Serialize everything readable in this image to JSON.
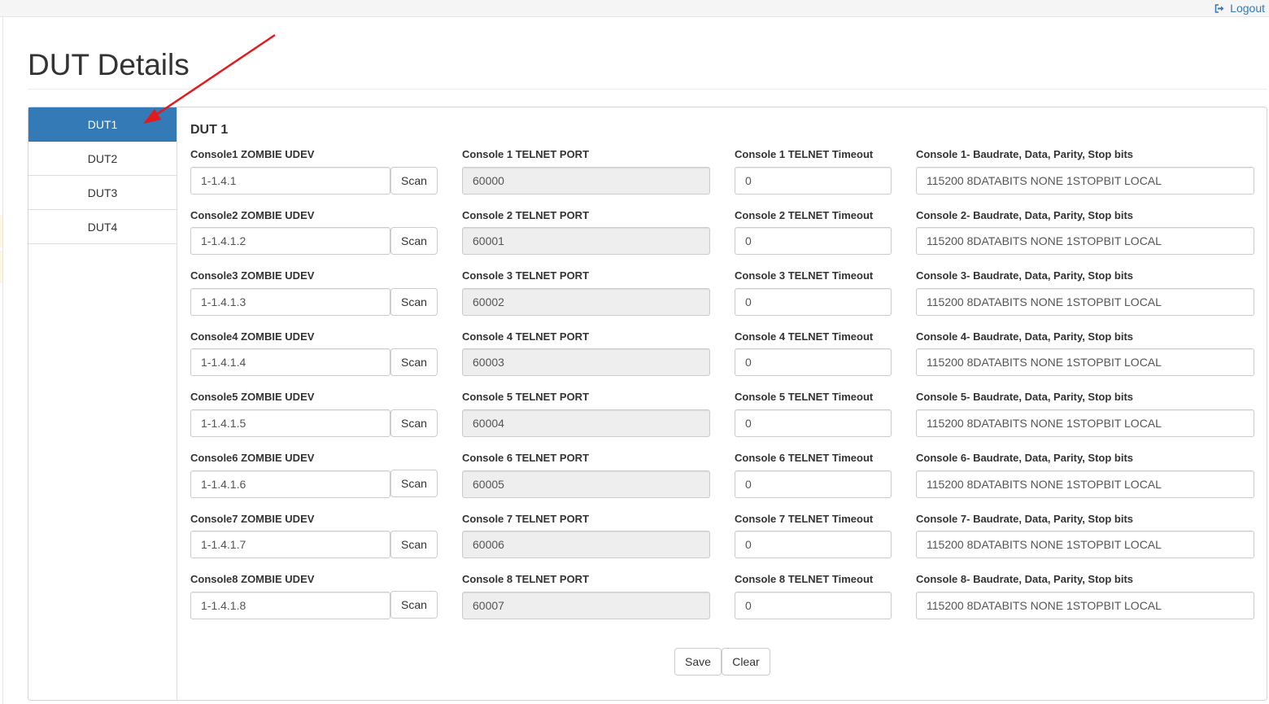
{
  "header": {
    "logout_label": "Logout"
  },
  "page": {
    "title": "DUT Details"
  },
  "sidebar": {
    "items": [
      {
        "label": "DUT1",
        "active": true
      },
      {
        "label": "DUT2",
        "active": false
      },
      {
        "label": "DUT3",
        "active": false
      },
      {
        "label": "DUT4",
        "active": false
      }
    ]
  },
  "form": {
    "heading": "DUT 1",
    "scan_label": "Scan",
    "rows": [
      {
        "udev_label": "Console1 ZOMBIE UDEV",
        "udev_value": "1-1.4.1",
        "port_label": "Console 1 TELNET PORT",
        "port_value": "60000",
        "timeout_label": "Console 1 TELNET Timeout",
        "timeout_value": "0",
        "baud_label": "Console 1- Baudrate, Data, Parity, Stop bits",
        "baud_value": "115200 8DATABITS NONE 1STOPBIT LOCAL"
      },
      {
        "udev_label": "Console2 ZOMBIE UDEV",
        "udev_value": "1-1.4.1.2",
        "port_label": "Console 2 TELNET PORT",
        "port_value": "60001",
        "timeout_label": "Console 2 TELNET Timeout",
        "timeout_value": "0",
        "baud_label": "Console 2- Baudrate, Data, Parity, Stop bits",
        "baud_value": "115200 8DATABITS NONE 1STOPBIT LOCAL"
      },
      {
        "udev_label": "Console3 ZOMBIE UDEV",
        "udev_value": "1-1.4.1.3",
        "port_label": "Console 3 TELNET PORT",
        "port_value": "60002",
        "timeout_label": "Console 3 TELNET Timeout",
        "timeout_value": "0",
        "baud_label": "Console 3- Baudrate, Data, Parity, Stop bits",
        "baud_value": "115200 8DATABITS NONE 1STOPBIT LOCAL"
      },
      {
        "udev_label": "Console4 ZOMBIE UDEV",
        "udev_value": "1-1.4.1.4",
        "port_label": "Console 4 TELNET PORT",
        "port_value": "60003",
        "timeout_label": "Console 4 TELNET Timeout",
        "timeout_value": "0",
        "baud_label": "Console 4- Baudrate, Data, Parity, Stop bits",
        "baud_value": "115200 8DATABITS NONE 1STOPBIT LOCAL"
      },
      {
        "udev_label": "Console5 ZOMBIE UDEV",
        "udev_value": "1-1.4.1.5",
        "port_label": "Console 5 TELNET PORT",
        "port_value": "60004",
        "timeout_label": "Console 5 TELNET Timeout",
        "timeout_value": "0",
        "baud_label": "Console 5- Baudrate, Data, Parity, Stop bits",
        "baud_value": "115200 8DATABITS NONE 1STOPBIT LOCAL"
      },
      {
        "udev_label": "Console6 ZOMBIE UDEV",
        "udev_value": "1-1.4.1.6",
        "port_label": "Console 6 TELNET PORT",
        "port_value": "60005",
        "timeout_label": "Console 6 TELNET Timeout",
        "timeout_value": "0",
        "baud_label": "Console 6- Baudrate, Data, Parity, Stop bits",
        "baud_value": "115200 8DATABITS NONE 1STOPBIT LOCAL"
      },
      {
        "udev_label": "Console7 ZOMBIE UDEV",
        "udev_value": "1-1.4.1.7",
        "port_label": "Console 7 TELNET PORT",
        "port_value": "60006",
        "timeout_label": "Console 7 TELNET Timeout",
        "timeout_value": "0",
        "baud_label": "Console 7- Baudrate, Data, Parity, Stop bits",
        "baud_value": "115200 8DATABITS NONE 1STOPBIT LOCAL"
      },
      {
        "udev_label": "Console8 ZOMBIE UDEV",
        "udev_value": "1-1.4.1.8",
        "port_label": "Console 8 TELNET PORT",
        "port_value": "60007",
        "timeout_label": "Console 8 TELNET Timeout",
        "timeout_value": "0",
        "baud_label": "Console 8- Baudrate, Data, Parity, Stop bits",
        "baud_value": "115200 8DATABITS NONE 1STOPBIT LOCAL"
      }
    ],
    "save_label": "Save",
    "clear_label": "Clear"
  },
  "colors": {
    "accent": "#337ab7",
    "annotation_arrow": "#e3191c",
    "readonly_bg": "#eeeeee"
  }
}
